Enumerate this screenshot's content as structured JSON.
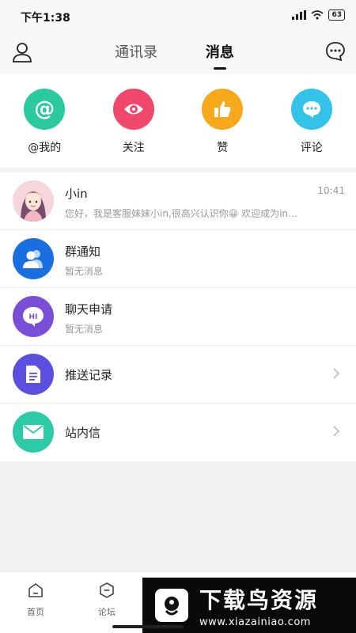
{
  "status_bar": {
    "time": "下午1:38",
    "battery": "63",
    "icons": [
      "signal-icon",
      "wifi-icon",
      "battery-icon"
    ]
  },
  "header": {
    "tabs": [
      {
        "label": "通讯录",
        "active": false
      },
      {
        "label": "消息",
        "active": true
      }
    ],
    "left_icon": "user-icon",
    "right_icon": "chat-bubble-icon"
  },
  "quick_actions": [
    {
      "label": "@我的",
      "icon": "at-icon",
      "color": "#2bc9a0"
    },
    {
      "label": "关注",
      "icon": "eye-icon",
      "color": "#f0476b"
    },
    {
      "label": "赞",
      "icon": "thumbs-up-icon",
      "color": "#f7a91b"
    },
    {
      "label": "评论",
      "icon": "comment-icon",
      "color": "#33c2e8"
    }
  ],
  "messages": [
    {
      "title": "小in",
      "subtitle": "您好，我是客服妹妹小in,很高兴认识你😀 欢迎成为in…",
      "time": "10:41",
      "icon": "girl-avatar"
    },
    {
      "title": "群通知",
      "subtitle": "暂无消息",
      "icon": "group-icon",
      "color": "#1a6fe0"
    },
    {
      "title": "聊天申请",
      "subtitle": "暂无消息",
      "icon": "hi-icon",
      "color": "#7a4fd8"
    },
    {
      "title": "推送记录",
      "icon": "document-icon",
      "color": "#5b4fe0"
    },
    {
      "title": "站内信",
      "icon": "envelope-icon",
      "color": "#2ccaa6"
    }
  ],
  "bottom_nav": [
    {
      "label": "首页",
      "icon": "home-icon"
    },
    {
      "label": "论坛",
      "icon": "forum-icon"
    }
  ],
  "watermark": {
    "title": "下载鸟资源",
    "url": "www.xiazainiao.com"
  }
}
